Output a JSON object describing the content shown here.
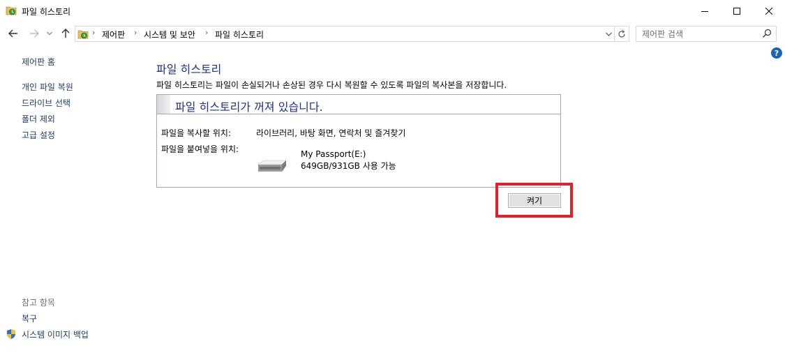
{
  "window": {
    "title": "파일 히스토리",
    "minimize_label": "",
    "maximize_label": "",
    "close_label": ""
  },
  "address": {
    "breadcrumbs": [
      "제어판",
      "시스템 및 보안",
      "파일 히스토리"
    ],
    "separator": "›"
  },
  "search": {
    "placeholder": "제어판 검색"
  },
  "sidebar": {
    "home": "제어판 홈",
    "items": [
      {
        "label": "개인 파일 복원"
      },
      {
        "label": "드라이브 선택"
      },
      {
        "label": "폴더 제외"
      },
      {
        "label": "고급 설정"
      }
    ],
    "see_also": {
      "heading": "참고 항목",
      "items": [
        {
          "label": "복구"
        },
        {
          "label": "시스템 이미지 백업"
        }
      ]
    }
  },
  "main": {
    "title": "파일 히스토리",
    "description": "파일 히스토리는 파일이 손실되거나 손상된 경우 다시 복원할 수 있도록 파일의 복사본을 저장합니다.",
    "status": {
      "heading": "파일 히스토리가 꺼져 있습니다.",
      "copy_from_label": "파일을 복사할 위치:",
      "copy_from_value": "라이브러리, 바탕 화면, 연락처 및 즐겨찾기",
      "copy_to_label": "파일을 붙여넣을 위치:",
      "drive_name": "My Passport(E:)",
      "drive_space": "649GB/931GB 사용 가능"
    },
    "turn_on_button": "켜기"
  },
  "colors": {
    "highlight": "#e3202a",
    "title_blue": "#1e3287",
    "link_blue": "#1e395b"
  }
}
